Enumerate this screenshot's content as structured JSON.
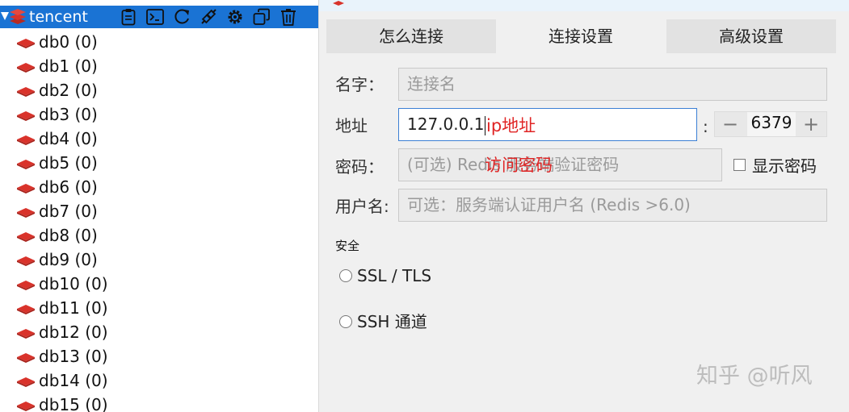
{
  "tree": {
    "connection_name": "tencent",
    "toolbar_icons": [
      "clipboard-icon",
      "terminal-icon",
      "refresh-icon",
      "disconnect-icon",
      "gear-icon",
      "copy-icon",
      "trash-icon"
    ],
    "databases": [
      {
        "label": "db0  (0)"
      },
      {
        "label": "db1  (0)"
      },
      {
        "label": "db2  (0)"
      },
      {
        "label": "db3  (0)"
      },
      {
        "label": "db4  (0)"
      },
      {
        "label": "db5  (0)"
      },
      {
        "label": "db6  (0)"
      },
      {
        "label": "db7  (0)"
      },
      {
        "label": "db8  (0)"
      },
      {
        "label": "db9  (0)"
      },
      {
        "label": "db10  (0)"
      },
      {
        "label": "db11  (0)"
      },
      {
        "label": "db12  (0)"
      },
      {
        "label": "db13  (0)"
      },
      {
        "label": "db14  (0)"
      },
      {
        "label": "db15  (0)"
      }
    ]
  },
  "dialog": {
    "tabs": [
      {
        "label": "怎么连接",
        "active": false
      },
      {
        "label": "连接设置",
        "active": true
      },
      {
        "label": "高级设置",
        "active": false
      }
    ],
    "name": {
      "label": "名字：",
      "placeholder": "连接名"
    },
    "address": {
      "label": "地址",
      "value": "127.0.0.1",
      "annotation": "ip地址",
      "colon": ":"
    },
    "port": {
      "value": "6379",
      "minus": "−",
      "plus": "+"
    },
    "password": {
      "label": "密码：",
      "placeholder": "(可选) Redis 服务端验证密码",
      "annotation": "访问密码",
      "show_label": "显示密码"
    },
    "username": {
      "label": "用户名:",
      "placeholder": "可选：服务端认证用户名 (Redis >6.0)"
    },
    "security": {
      "label": "安全",
      "ssl": "SSL / TLS",
      "ssh": "SSH 通道"
    }
  },
  "watermark": "知乎 @听风",
  "colors": {
    "accent": "#1a73d4",
    "db_icon": "#d9332b",
    "annotation": "#e02424"
  }
}
